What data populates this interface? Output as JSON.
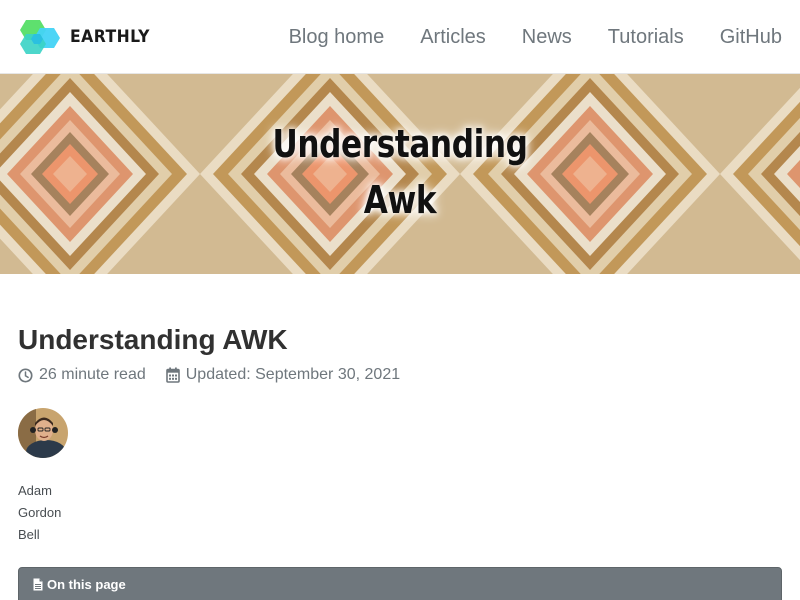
{
  "brand": {
    "logo_text": "EARTHLY"
  },
  "nav": {
    "items": [
      {
        "label": "Blog home"
      },
      {
        "label": "Articles"
      },
      {
        "label": "News"
      },
      {
        "label": "Tutorials"
      },
      {
        "label": "GitHub"
      }
    ]
  },
  "hero": {
    "title_line1": "Understanding",
    "title_line2": "Awk"
  },
  "article": {
    "title": "Understanding AWK",
    "read_time": "26 minute read",
    "updated": "Updated: September 30, 2021"
  },
  "author": {
    "name_lines": [
      "Adam",
      "Gordon",
      "Bell"
    ]
  },
  "toc": {
    "header": "On this page"
  },
  "icons": {
    "read_time": "clock-icon",
    "updated": "calendar-icon",
    "toc": "file-icon"
  },
  "colors": {
    "nav_text": "#6f777d",
    "toc_background": "#6f777d",
    "logo_green": "#4cd964",
    "logo_cyan": "#34d8f0",
    "hero_orange": "#f28a5e",
    "hero_tan": "#c9a46b"
  }
}
